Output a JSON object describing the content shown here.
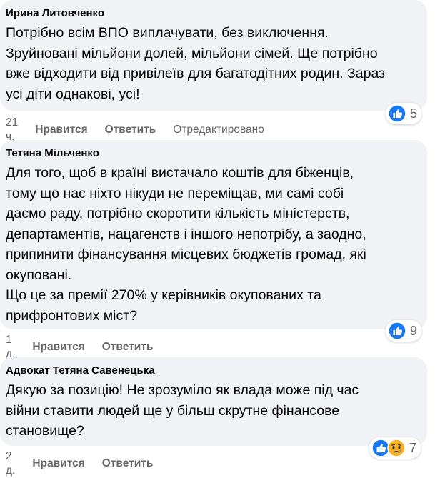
{
  "comments": [
    {
      "author": "Ирина Литовченко",
      "text": "Потрібно всім ВПО виплачувати, без виключення.\nЗруйновані мільйони долей, мільйони сімей. Ще потрібно\nвже відходити від привілеїв для багатодітних родин. Зараз\nусі діти однакові, усі!",
      "time": "21 ч.",
      "like_label": "Нравится",
      "reply_label": "Ответить",
      "edited_label": "Отредактировано",
      "reaction_count": "5",
      "reaction_icons": [
        "like-icon"
      ]
    },
    {
      "author": "Тетяна Мільченко",
      "text": "Для того, щоб в країні вистачало коштів для біженців,\nтому що нас ніхто нікуди не переміщав, ми самі собі\nдаємо раду, потрібно скоротити кількість міністерств,\nдепартаментів, нацагенств і іншого непотрібу, а заодно,\nприпинити фінансування місцевих бюджетів громад, які\nокуповані.\nЩо це за премії 270% у керівників окупованих та\nприфронтових міст?",
      "time": "1 д.",
      "like_label": "Нравится",
      "reply_label": "Ответить",
      "reaction_count": "9",
      "reaction_icons": [
        "like-icon"
      ]
    },
    {
      "author": "Адвокат Тетяна Савенецька",
      "text": "Дякую за позицію! Не зрозуміло як влада може під час\nвійни ставити людей ще у більш скрутне фінансове\nстановище?",
      "time": "2 д.",
      "like_label": "Нравится",
      "reply_label": "Ответить",
      "reaction_count": "7",
      "reaction_icons": [
        "like-icon",
        "sad-icon"
      ]
    }
  ],
  "colors": {
    "bubble": "#f0f2f5",
    "text": "#050505",
    "secondary": "#65676b",
    "like_blue": "#1877f2",
    "sad_yellow": "#f7b125"
  }
}
